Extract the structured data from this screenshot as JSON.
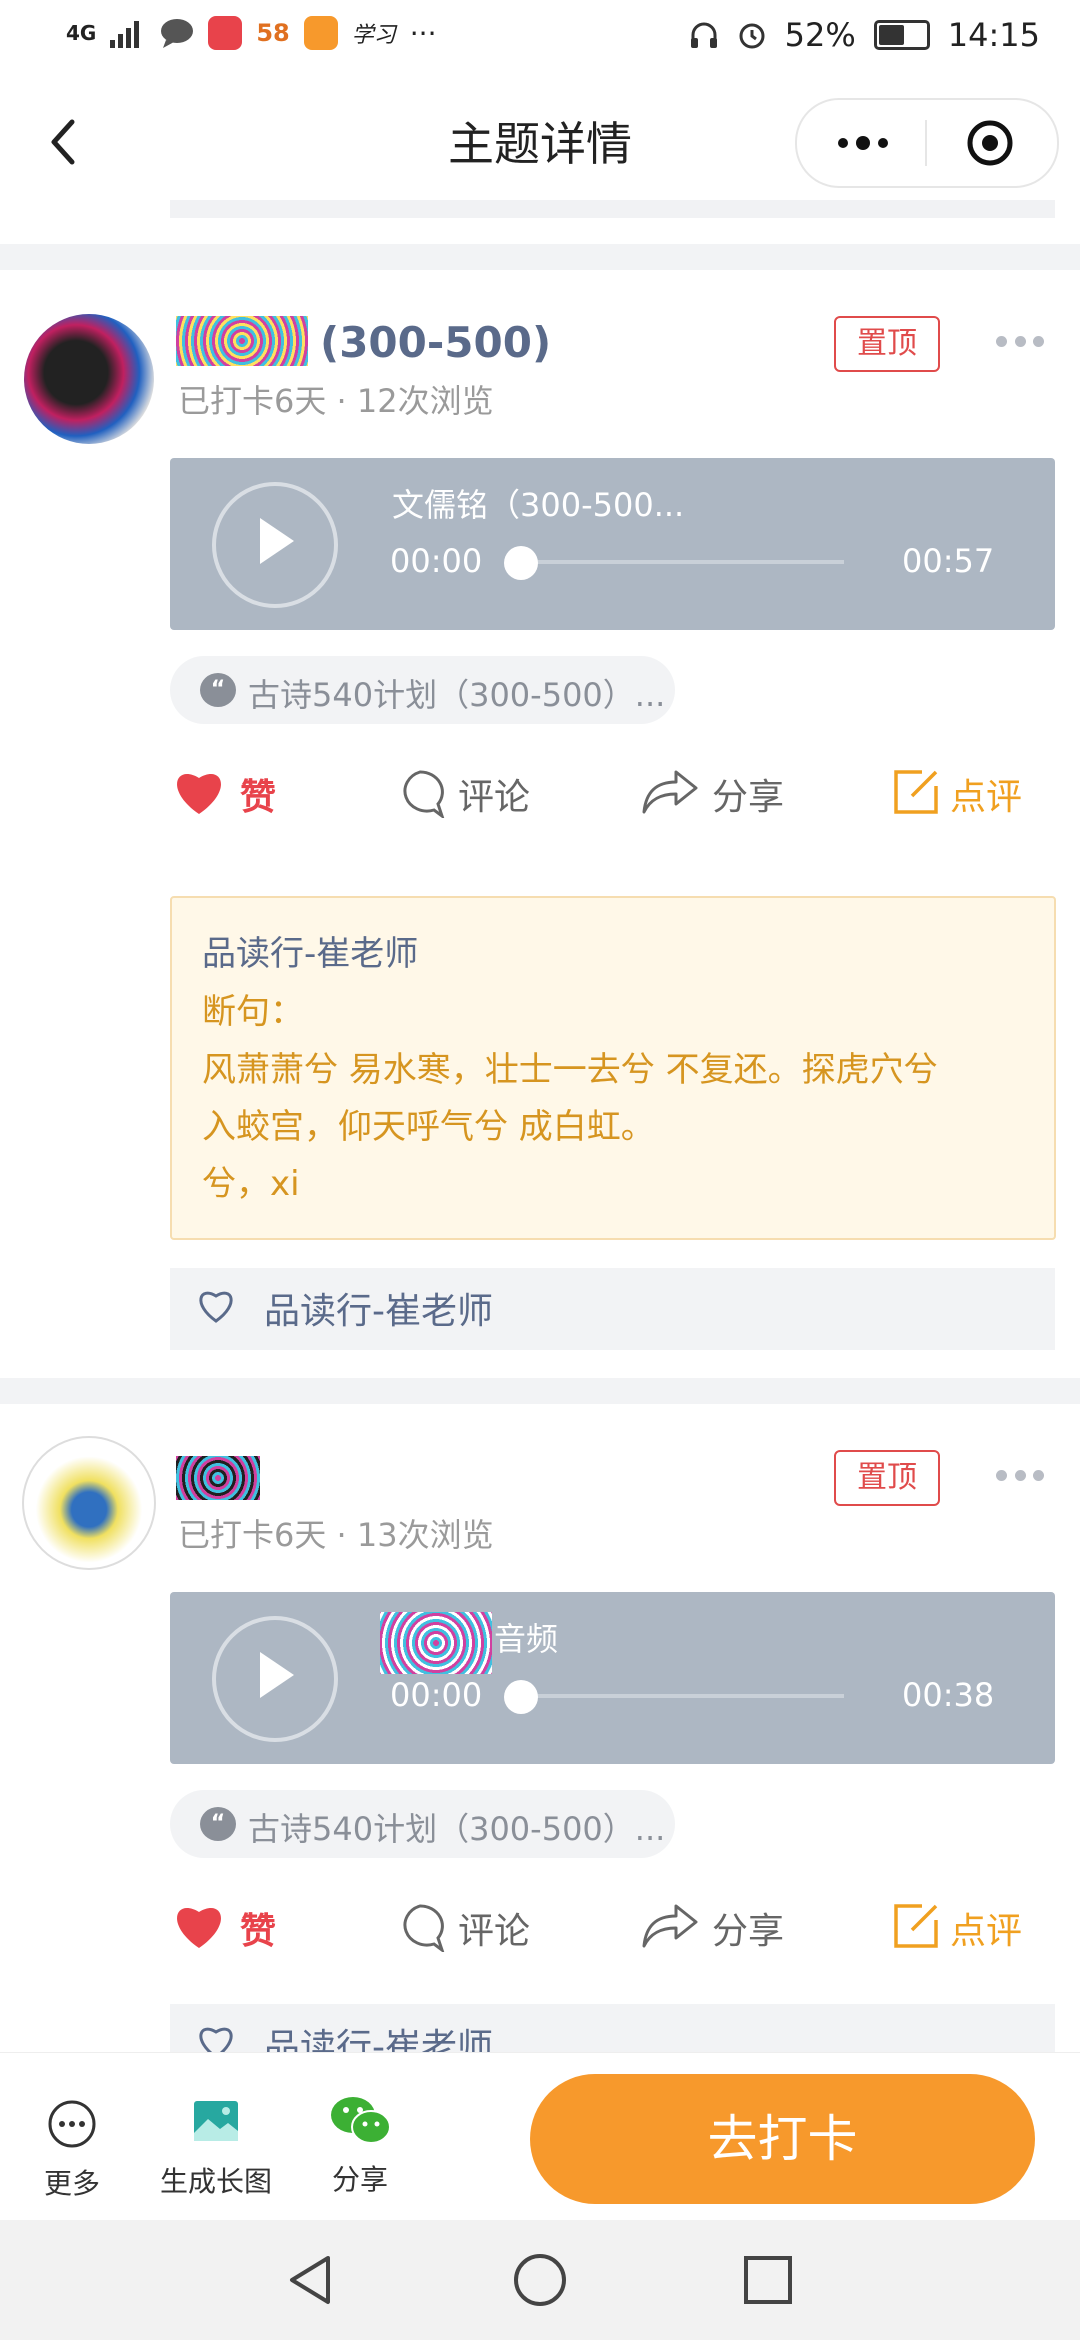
{
  "status_bar": {
    "network": "4G",
    "mini_app_labels": [
      "58",
      "学习"
    ],
    "more": "···",
    "battery": "52%",
    "time": "14:15"
  },
  "header": {
    "title": "主题详情"
  },
  "posts": [
    {
      "nickname": "(300-500)",
      "meta": "已打卡6天 · 12次浏览",
      "pin_label": "置顶",
      "audio_title": "文儒铭（300-500...",
      "audio_start": "00:00",
      "audio_end": "00:57",
      "tag": "古诗540计划（300-500）...",
      "actions": {
        "like": "赞",
        "comment": "评论",
        "share": "分享",
        "review": "点评"
      },
      "review": {
        "reviewer": "品读行-崔老师",
        "label": "断句：",
        "line1": "风萧萧兮 易水寒，壮士一去兮 不复还。探虎穴兮",
        "line2": "入蛟宫，仰天呼气兮 成白虹。",
        "line3": "兮，xi"
      },
      "liked_by": "品读行-崔老师"
    },
    {
      "nickname": "",
      "meta": "已打卡6天 · 13次浏览",
      "pin_label": "置顶",
      "audio_title": "音频",
      "audio_start": "00:00",
      "audio_end": "00:38",
      "tag": "古诗540计划（300-500）...",
      "actions": {
        "like": "赞",
        "comment": "评论",
        "share": "分享",
        "review": "点评"
      },
      "liked_by": "品读行-崔老师"
    }
  ],
  "bottom_bar": {
    "more": "更多",
    "long_image": "生成长图",
    "share": "分享",
    "checkin": "去打卡"
  },
  "colors": {
    "accent": "#f7992c",
    "like_red": "#e8434b",
    "review_orange": "#f0a020",
    "nick_blue": "#5a6a8a"
  }
}
